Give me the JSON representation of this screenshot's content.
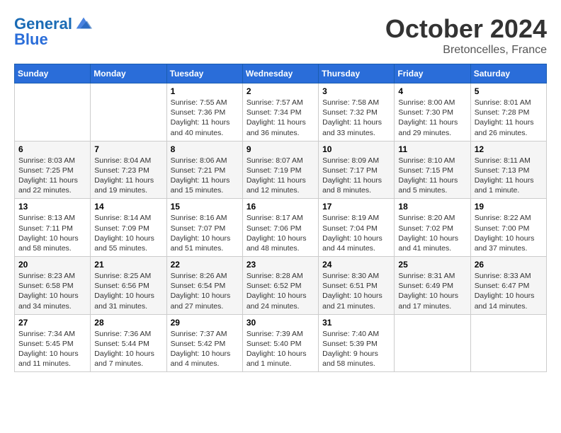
{
  "header": {
    "logo_line1": "General",
    "logo_line2": "Blue",
    "month_title": "October 2024",
    "location": "Bretoncelles, France"
  },
  "weekdays": [
    "Sunday",
    "Monday",
    "Tuesday",
    "Wednesday",
    "Thursday",
    "Friday",
    "Saturday"
  ],
  "weeks": [
    [
      {
        "day": "",
        "sunrise": "",
        "sunset": "",
        "daylight": ""
      },
      {
        "day": "",
        "sunrise": "",
        "sunset": "",
        "daylight": ""
      },
      {
        "day": "1",
        "sunrise": "Sunrise: 7:55 AM",
        "sunset": "Sunset: 7:36 PM",
        "daylight": "Daylight: 11 hours and 40 minutes."
      },
      {
        "day": "2",
        "sunrise": "Sunrise: 7:57 AM",
        "sunset": "Sunset: 7:34 PM",
        "daylight": "Daylight: 11 hours and 36 minutes."
      },
      {
        "day": "3",
        "sunrise": "Sunrise: 7:58 AM",
        "sunset": "Sunset: 7:32 PM",
        "daylight": "Daylight: 11 hours and 33 minutes."
      },
      {
        "day": "4",
        "sunrise": "Sunrise: 8:00 AM",
        "sunset": "Sunset: 7:30 PM",
        "daylight": "Daylight: 11 hours and 29 minutes."
      },
      {
        "day": "5",
        "sunrise": "Sunrise: 8:01 AM",
        "sunset": "Sunset: 7:28 PM",
        "daylight": "Daylight: 11 hours and 26 minutes."
      }
    ],
    [
      {
        "day": "6",
        "sunrise": "Sunrise: 8:03 AM",
        "sunset": "Sunset: 7:25 PM",
        "daylight": "Daylight: 11 hours and 22 minutes."
      },
      {
        "day": "7",
        "sunrise": "Sunrise: 8:04 AM",
        "sunset": "Sunset: 7:23 PM",
        "daylight": "Daylight: 11 hours and 19 minutes."
      },
      {
        "day": "8",
        "sunrise": "Sunrise: 8:06 AM",
        "sunset": "Sunset: 7:21 PM",
        "daylight": "Daylight: 11 hours and 15 minutes."
      },
      {
        "day": "9",
        "sunrise": "Sunrise: 8:07 AM",
        "sunset": "Sunset: 7:19 PM",
        "daylight": "Daylight: 11 hours and 12 minutes."
      },
      {
        "day": "10",
        "sunrise": "Sunrise: 8:09 AM",
        "sunset": "Sunset: 7:17 PM",
        "daylight": "Daylight: 11 hours and 8 minutes."
      },
      {
        "day": "11",
        "sunrise": "Sunrise: 8:10 AM",
        "sunset": "Sunset: 7:15 PM",
        "daylight": "Daylight: 11 hours and 5 minutes."
      },
      {
        "day": "12",
        "sunrise": "Sunrise: 8:11 AM",
        "sunset": "Sunset: 7:13 PM",
        "daylight": "Daylight: 11 hours and 1 minute."
      }
    ],
    [
      {
        "day": "13",
        "sunrise": "Sunrise: 8:13 AM",
        "sunset": "Sunset: 7:11 PM",
        "daylight": "Daylight: 10 hours and 58 minutes."
      },
      {
        "day": "14",
        "sunrise": "Sunrise: 8:14 AM",
        "sunset": "Sunset: 7:09 PM",
        "daylight": "Daylight: 10 hours and 55 minutes."
      },
      {
        "day": "15",
        "sunrise": "Sunrise: 8:16 AM",
        "sunset": "Sunset: 7:07 PM",
        "daylight": "Daylight: 10 hours and 51 minutes."
      },
      {
        "day": "16",
        "sunrise": "Sunrise: 8:17 AM",
        "sunset": "Sunset: 7:06 PM",
        "daylight": "Daylight: 10 hours and 48 minutes."
      },
      {
        "day": "17",
        "sunrise": "Sunrise: 8:19 AM",
        "sunset": "Sunset: 7:04 PM",
        "daylight": "Daylight: 10 hours and 44 minutes."
      },
      {
        "day": "18",
        "sunrise": "Sunrise: 8:20 AM",
        "sunset": "Sunset: 7:02 PM",
        "daylight": "Daylight: 10 hours and 41 minutes."
      },
      {
        "day": "19",
        "sunrise": "Sunrise: 8:22 AM",
        "sunset": "Sunset: 7:00 PM",
        "daylight": "Daylight: 10 hours and 37 minutes."
      }
    ],
    [
      {
        "day": "20",
        "sunrise": "Sunrise: 8:23 AM",
        "sunset": "Sunset: 6:58 PM",
        "daylight": "Daylight: 10 hours and 34 minutes."
      },
      {
        "day": "21",
        "sunrise": "Sunrise: 8:25 AM",
        "sunset": "Sunset: 6:56 PM",
        "daylight": "Daylight: 10 hours and 31 minutes."
      },
      {
        "day": "22",
        "sunrise": "Sunrise: 8:26 AM",
        "sunset": "Sunset: 6:54 PM",
        "daylight": "Daylight: 10 hours and 27 minutes."
      },
      {
        "day": "23",
        "sunrise": "Sunrise: 8:28 AM",
        "sunset": "Sunset: 6:52 PM",
        "daylight": "Daylight: 10 hours and 24 minutes."
      },
      {
        "day": "24",
        "sunrise": "Sunrise: 8:30 AM",
        "sunset": "Sunset: 6:51 PM",
        "daylight": "Daylight: 10 hours and 21 minutes."
      },
      {
        "day": "25",
        "sunrise": "Sunrise: 8:31 AM",
        "sunset": "Sunset: 6:49 PM",
        "daylight": "Daylight: 10 hours and 17 minutes."
      },
      {
        "day": "26",
        "sunrise": "Sunrise: 8:33 AM",
        "sunset": "Sunset: 6:47 PM",
        "daylight": "Daylight: 10 hours and 14 minutes."
      }
    ],
    [
      {
        "day": "27",
        "sunrise": "Sunrise: 7:34 AM",
        "sunset": "Sunset: 5:45 PM",
        "daylight": "Daylight: 10 hours and 11 minutes."
      },
      {
        "day": "28",
        "sunrise": "Sunrise: 7:36 AM",
        "sunset": "Sunset: 5:44 PM",
        "daylight": "Daylight: 10 hours and 7 minutes."
      },
      {
        "day": "29",
        "sunrise": "Sunrise: 7:37 AM",
        "sunset": "Sunset: 5:42 PM",
        "daylight": "Daylight: 10 hours and 4 minutes."
      },
      {
        "day": "30",
        "sunrise": "Sunrise: 7:39 AM",
        "sunset": "Sunset: 5:40 PM",
        "daylight": "Daylight: 10 hours and 1 minute."
      },
      {
        "day": "31",
        "sunrise": "Sunrise: 7:40 AM",
        "sunset": "Sunset: 5:39 PM",
        "daylight": "Daylight: 9 hours and 58 minutes."
      },
      {
        "day": "",
        "sunrise": "",
        "sunset": "",
        "daylight": ""
      },
      {
        "day": "",
        "sunrise": "",
        "sunset": "",
        "daylight": ""
      }
    ]
  ]
}
